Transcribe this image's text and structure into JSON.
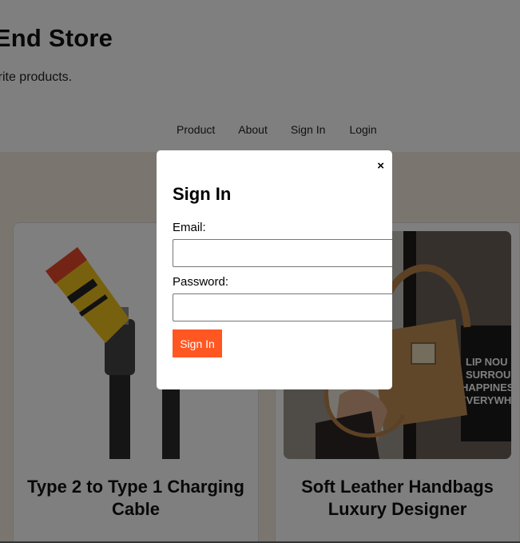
{
  "header": {
    "store_title": "BackEnd Store",
    "tagline": "Shop your favorite products."
  },
  "nav": {
    "items": [
      {
        "label": "Product"
      },
      {
        "label": "About"
      },
      {
        "label": "Sign In"
      },
      {
        "label": "Login"
      }
    ]
  },
  "products": [
    {
      "title": "Type 2 to Type 1 Charging Cable",
      "image": "charging-cable-image"
    },
    {
      "title": "Soft Leather Handbags Luxury Designer",
      "image": "leather-handbag-image"
    }
  ],
  "product_image_text": {
    "poster_lines": [
      "LIP NOU",
      "SURROUN",
      "HAPPINES",
      "EVERYWHE"
    ]
  },
  "modal": {
    "title": "Sign In",
    "close_glyph": "×",
    "email_label": "Email:",
    "email_value": "",
    "password_label": "Password:",
    "password_value": "",
    "submit_label": "Sign In"
  },
  "colors": {
    "accent": "#ff5722",
    "overlay": "rgba(0,0,0,0.5)",
    "page_background": "#f4ebdf"
  }
}
